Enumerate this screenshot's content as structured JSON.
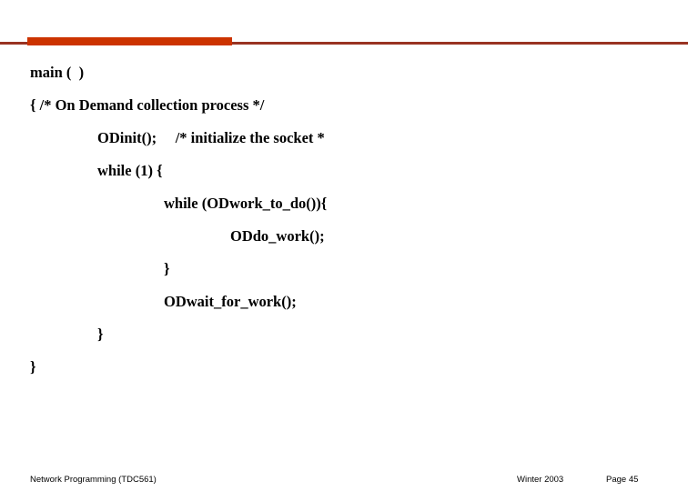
{
  "slide": {
    "accent_bar_color": "#CC3300",
    "accent_rule_color": "#993322",
    "background_color": "#FFFFFF",
    "code_lines": [
      {
        "text": "main (  )",
        "indent": 0
      },
      {
        "text": "{ /* On Demand collection process */",
        "indent": 0
      },
      {
        "text": "ODinit();     /* initialize the socket *",
        "indent": 1
      },
      {
        "text": "while (1) {",
        "indent": 1
      },
      {
        "text": "while (ODwork_to_do()){",
        "indent": 2
      },
      {
        "text": "ODdo_work();",
        "indent": 3
      },
      {
        "text": "}",
        "indent": 2
      },
      {
        "text": "ODwait_for_work();",
        "indent": 2
      },
      {
        "text": "}",
        "indent": 1
      },
      {
        "text": "}",
        "indent": 0
      }
    ]
  },
  "footer": {
    "course": "Network Programming (TDC561)",
    "term": "Winter  2003",
    "page": "Page 45"
  }
}
